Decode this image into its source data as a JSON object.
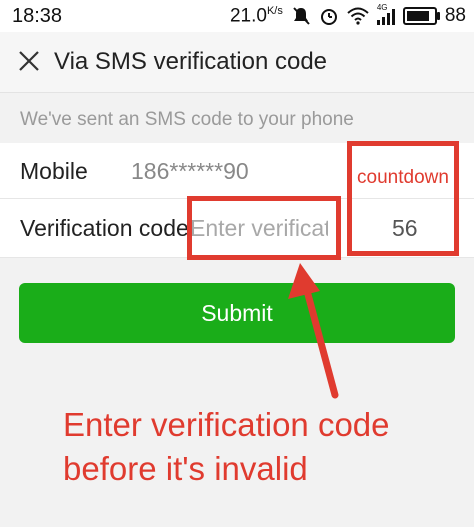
{
  "status_bar": {
    "time": "18:38",
    "speed": "21.0",
    "speed_unit": "K/s",
    "network_label": "4G",
    "battery": "88",
    "icons": [
      "mute-icon",
      "alarm-icon",
      "wifi-icon",
      "signal-icon",
      "battery-icon"
    ]
  },
  "header": {
    "title": "Via SMS verification code",
    "close_icon": "close-icon"
  },
  "notice": "We've sent an SMS code to your phone",
  "form": {
    "mobile_label": "Mobile",
    "mobile_value": "186******90",
    "code_label": "Verification code",
    "code_value": "",
    "code_placeholder": "Enter verification code",
    "countdown_value": "56"
  },
  "submit_label": "Submit",
  "annotation": {
    "countdown_label": "countdown",
    "caption_line1": "Enter verification code",
    "caption_line2": "before it's invalid",
    "color": "#e03b2f"
  },
  "colors": {
    "primary_green": "#1aad19",
    "background_gray": "#f2f2f2"
  }
}
